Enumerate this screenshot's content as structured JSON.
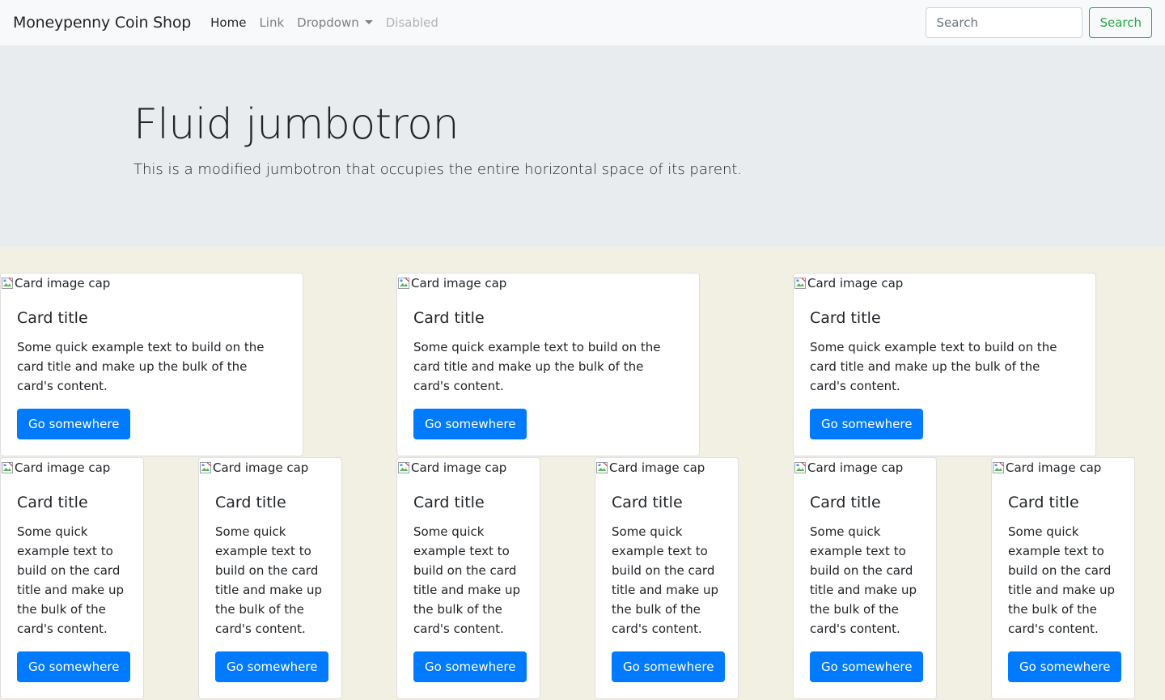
{
  "navbar": {
    "brand": "Moneypenny Coin Shop",
    "links": [
      {
        "label": "Home"
      },
      {
        "label": "Link"
      },
      {
        "label": "Dropdown"
      },
      {
        "label": "Disabled"
      }
    ],
    "search_placeholder": "Search",
    "search_button": "Search"
  },
  "jumbotron": {
    "title": "Fluid jumbotron",
    "lead": "This is a modified jumbotron that occupies the entire horizontal space of its parent."
  },
  "cards": [
    {
      "img_alt": "Card image cap",
      "title": "Card title",
      "text": "Some quick example text to build on the card title and make up the bulk of the card's content.",
      "button": "Go somewhere"
    },
    {
      "img_alt": "Card image cap",
      "title": "Card title",
      "text": "Some quick example text to build on the card title and make up the bulk of the card's content.",
      "button": "Go somewhere"
    },
    {
      "img_alt": "Card image cap",
      "title": "Card title",
      "text": "Some quick example text to build on the card title and make up the bulk of the card's content.",
      "button": "Go somewhere"
    },
    {
      "img_alt": "Card image cap",
      "title": "Card title",
      "text": "Some quick example text to build on the card title and make up the bulk of the card's content.",
      "button": "Go somewhere"
    },
    {
      "img_alt": "Card image cap",
      "title": "Card title",
      "text": "Some quick example text to build on the card title and make up the bulk of the card's content.",
      "button": "Go somewhere"
    },
    {
      "img_alt": "Card image cap",
      "title": "Card title",
      "text": "Some quick example text to build on the card title and make up the bulk of the card's content.",
      "button": "Go somewhere"
    },
    {
      "img_alt": "Card image cap",
      "title": "Card title",
      "text": "Some quick example text to build on the card title and make up the bulk of the card's content.",
      "button": "Go somewhere"
    },
    {
      "img_alt": "Card image cap",
      "title": "Card title",
      "text": "Some quick example text to build on the card title and make up the bulk of the card's content.",
      "button": "Go somewhere"
    },
    {
      "img_alt": "Card image cap",
      "title": "Card title",
      "text": "Some quick example text to build on the card title and make up the bulk of the card's content.",
      "button": "Go somewhere"
    }
  ]
}
